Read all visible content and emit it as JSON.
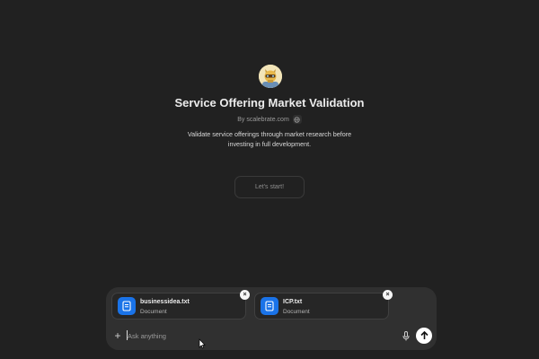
{
  "gpt": {
    "title": "Service Offering Market Validation",
    "byline": "By scalebrate.com",
    "description": "Validate service offerings through market research before investing in full development."
  },
  "conversation_starters": [
    {
      "label": "Let's start!"
    }
  ],
  "composer": {
    "attachments": [
      {
        "name": "businessidea.txt",
        "type": "Document"
      },
      {
        "name": "ICP.txt",
        "type": "Document"
      }
    ],
    "input": {
      "placeholder": "Ask anything",
      "value": ""
    }
  },
  "icons": {
    "avatar": "robot-avatar-icon",
    "byline_badge": "globe-icon",
    "attachment": "document-icon",
    "remove": "close-icon",
    "add": "plus-icon",
    "voice": "microphone-icon",
    "send": "arrow-up-icon"
  },
  "colors": {
    "background": "#212121",
    "composer": "#303030",
    "file_icon": "#1a73e8",
    "send_button": "#ffffff"
  }
}
